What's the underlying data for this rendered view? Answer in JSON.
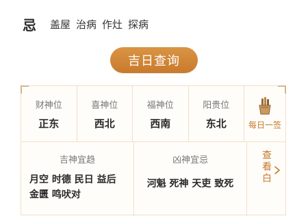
{
  "ji": {
    "title": "忌",
    "items": [
      "盖屋",
      "治病",
      "作灶",
      "探病"
    ]
  },
  "button": {
    "label": "吉日查询"
  },
  "positions": [
    {
      "label": "财神位",
      "value": "正东"
    },
    {
      "label": "喜神位",
      "value": "西北"
    },
    {
      "label": "福神位",
      "value": "西南"
    },
    {
      "label": "阳贵位",
      "value": "东北"
    }
  ],
  "daily_sign": {
    "label": "每日一签",
    "icon": "fortune-sticks-icon"
  },
  "auspicious": {
    "label": "吉神宜趋",
    "text": "月空 时德 民日 益后 金匮 鸣吠对"
  },
  "inauspicious": {
    "label": "凶神宜忌",
    "text": "河魁 死神 天吏 致死"
  },
  "more": {
    "label": "查看白",
    "icon": "chevron-right-icon"
  },
  "colors": {
    "accent": "#c97a2c",
    "border": "#f0dfc9",
    "corner": "#d9b48a"
  }
}
